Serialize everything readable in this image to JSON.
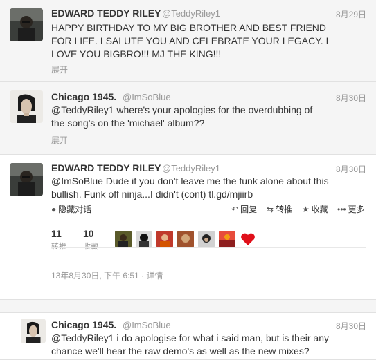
{
  "tweets": [
    {
      "name": "EDWARD TEDDY RILEY",
      "handle": "@TeddyRiley1",
      "time": "8月29日",
      "text": "HAPPY BIRTHDAY TO MY BIG BROTHER AND BEST FRIEND FOR LIFE. I SALUTE YOU AND CELEBRATE YOUR LEGACY. I LOVE YOU BIGBRO!!! MJ THE KING!!!",
      "expand": "展开"
    },
    {
      "name": "Chicago 1945.",
      "handle": "@ImSoBlue",
      "time": "8月30日",
      "text": "@TeddyRiley1 where's your apologies for the overdubbing of the song's on the 'michael' album??",
      "expand": "展开"
    },
    {
      "name": "EDWARD TEDDY RILEY",
      "handle": "@TeddyRiley1",
      "time": "8月30日",
      "text": "@ImSoBlue Dude if you don't leave me the funk alone about this bullish. Funk off ninja...I didn't (cont) tl.gd/mjiirb",
      "actions": {
        "hide_conversation": "隐藏对话",
        "reply": "回复",
        "retweet": "转推",
        "favorite": "收藏",
        "more": "更多"
      },
      "stats": {
        "retweets_count": "11",
        "retweets_label": "转推",
        "favorites_count": "10",
        "favorites_label": "收藏"
      },
      "detail": "13年8月30日, 下午 6:51 · 详情"
    },
    {
      "name": "Chicago 1945.",
      "handle": "@ImSoBlue",
      "time": "8月30日",
      "text": "@TeddyRiley1 i do apologise for what i said man, but is their any chance we'll hear the raw demo's as well as the new mixes?"
    }
  ]
}
